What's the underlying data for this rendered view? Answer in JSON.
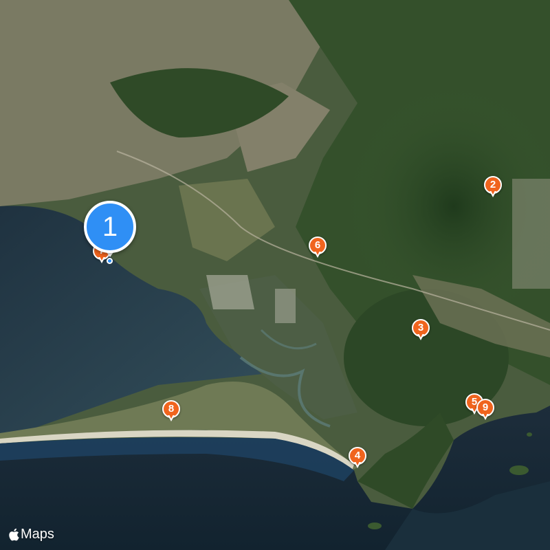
{
  "map": {
    "provider_logo_text": "Maps",
    "selected_cluster": {
      "label": "1",
      "color": "#2f8ff5"
    },
    "pin_color": "#f0641e",
    "markers": [
      {
        "label": "7"
      },
      {
        "label": "2"
      },
      {
        "label": "6"
      },
      {
        "label": "3"
      },
      {
        "label": "5"
      },
      {
        "label": "9"
      },
      {
        "label": "8"
      },
      {
        "label": "4"
      }
    ]
  }
}
